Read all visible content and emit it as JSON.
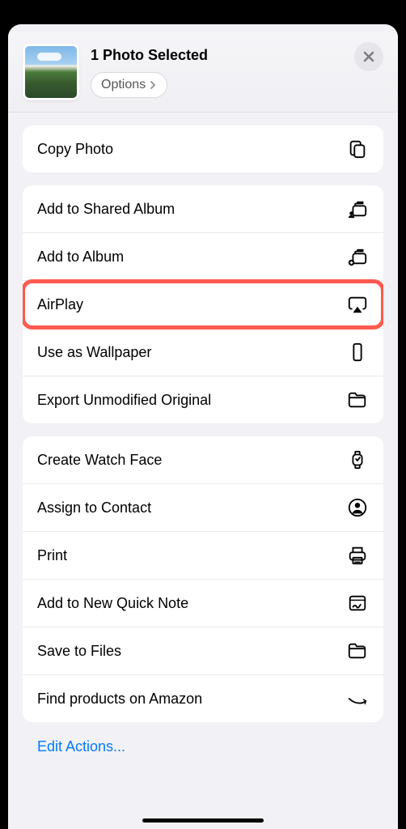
{
  "header": {
    "title": "1 Photo Selected",
    "options_label": "Options"
  },
  "groups": [
    {
      "rows": [
        {
          "label": "Copy Photo",
          "icon": "copy-icon"
        }
      ]
    },
    {
      "rows": [
        {
          "label": "Add to Shared Album",
          "icon": "shared-album-icon"
        },
        {
          "label": "Add to Album",
          "icon": "add-album-icon"
        },
        {
          "label": "AirPlay",
          "icon": "airplay-icon",
          "highlighted": true
        },
        {
          "label": "Use as Wallpaper",
          "icon": "wallpaper-icon"
        },
        {
          "label": "Export Unmodified Original",
          "icon": "folder-icon"
        }
      ]
    },
    {
      "rows": [
        {
          "label": "Create Watch Face",
          "icon": "watch-icon"
        },
        {
          "label": "Assign to Contact",
          "icon": "contact-icon"
        },
        {
          "label": "Print",
          "icon": "print-icon"
        },
        {
          "label": "Add to New Quick Note",
          "icon": "quick-note-icon"
        },
        {
          "label": "Save to Files",
          "icon": "folder-icon"
        },
        {
          "label": "Find products on Amazon",
          "icon": "amazon-icon"
        }
      ]
    }
  ],
  "edit_actions_label": "Edit Actions..."
}
